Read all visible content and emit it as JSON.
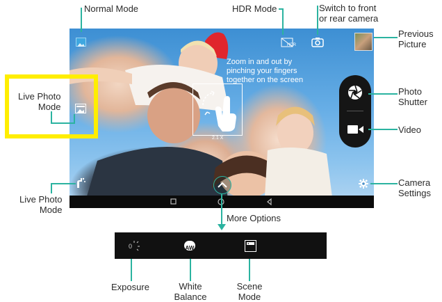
{
  "labels": {
    "normal_mode": "Normal Mode",
    "hdr_mode": "HDR Mode",
    "switch_camera_line1": "Switch to front",
    "switch_camera_line2": "or rear camera",
    "previous_picture_line1": "Previous",
    "previous_picture_line2": "Picture",
    "live_photo_mode_top_line1": "Live Photo",
    "live_photo_mode_top_line2": "Mode",
    "photo_shutter_line1": "Photo",
    "photo_shutter_line2": "Shutter",
    "video": "Video",
    "camera_settings_line1": "Camera",
    "camera_settings_line2": "Settings",
    "live_photo_mode_bottom_line1": "Live Photo",
    "live_photo_mode_bottom_line2": "Mode",
    "more_options": "More Options",
    "exposure": "Exposure",
    "white_balance_line1": "White",
    "white_balance_line2": "Balance",
    "scene_mode_line1": "Scene",
    "scene_mode_line2": "Mode"
  },
  "screen": {
    "hint_line1": "Zoom in and out by",
    "hint_line2": "pinching your fingers",
    "hint_line3": "together on the screen",
    "zoom_level": "2.1 X",
    "hdr_badge": "HDR",
    "exposure_value": "0",
    "white_balance_icon_text": "AW"
  },
  "colors": {
    "accent": "#2bb3a0",
    "highlight": "#ffee00",
    "panel": "#151515"
  }
}
